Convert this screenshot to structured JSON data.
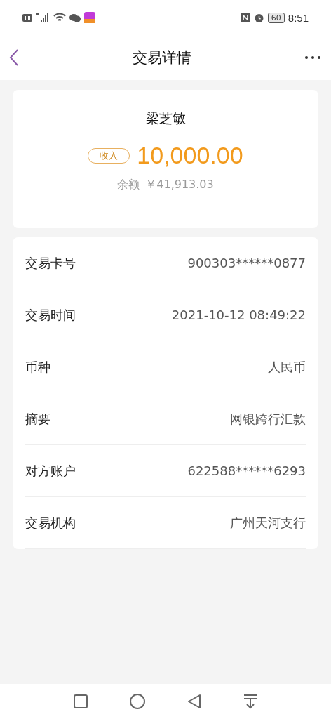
{
  "status_bar": {
    "battery": "60",
    "time": "8:51"
  },
  "header": {
    "title": "交易详情"
  },
  "summary": {
    "name": "梁芝敏",
    "type_tag": "收入",
    "amount": "10,000.00",
    "balance_label": "余额",
    "balance": "￥41,913.03"
  },
  "details": [
    {
      "label": "交易卡号",
      "value": "900303******0877"
    },
    {
      "label": "交易时间",
      "value": "2021-10-12 08:49:22"
    },
    {
      "label": "币种",
      "value": "人民币"
    },
    {
      "label": "摘要",
      "value": "网银跨行汇款"
    },
    {
      "label": "对方账户",
      "value": "622588******6293"
    },
    {
      "label": "交易机构",
      "value": "广州天河支行"
    }
  ]
}
